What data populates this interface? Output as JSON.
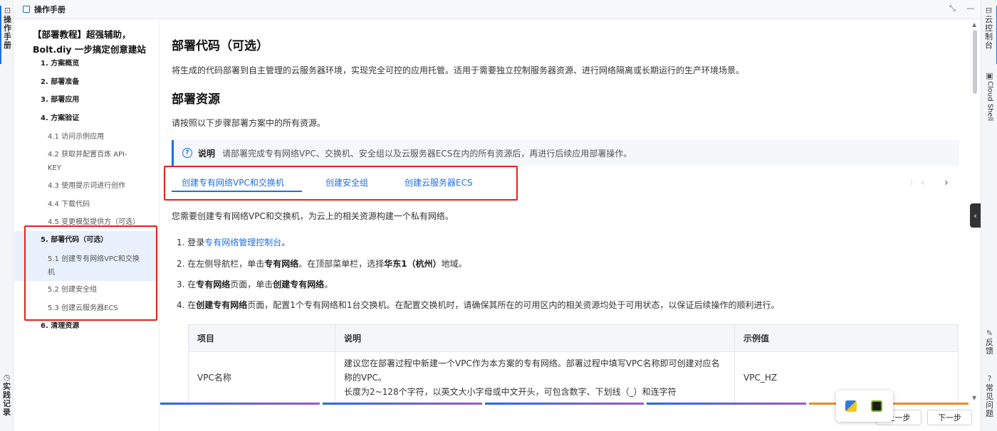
{
  "header": {
    "title": "操作手册"
  },
  "left_rail": {
    "manual_label": "操作手册",
    "practice_label": "实践记录"
  },
  "right_rail": {
    "console_label": "云控制台",
    "cloudshell_label": "Cloud Shell",
    "feedback_label": "反馈",
    "faq_label": "常见问题"
  },
  "toc": {
    "title": "【部署教程】超强辅助，Bolt.diy 一步搞定创意建站",
    "items": [
      {
        "label": "1. 方案概览"
      },
      {
        "label": "2. 部署准备"
      },
      {
        "label": "3. 部署应用"
      },
      {
        "label": "4. 方案验证"
      }
    ],
    "sub4": [
      {
        "label": "4.1 访问示例应用"
      },
      {
        "label": "4.2 获取并配置百炼 API-KEY"
      },
      {
        "label": "4.3 使用提示词进行创作"
      },
      {
        "label": "4.4 下载代码"
      },
      {
        "label": "4.5 变更模型提供方（可选）"
      }
    ],
    "item5": "5. 部署代码（可选）",
    "sub5": [
      {
        "label": "5.1 创建专有网络VPC和交换机"
      },
      {
        "label": "5.2 创建安全组"
      },
      {
        "label": "5.3 创建云服务器ECS"
      }
    ],
    "item6": "6. 清理资源"
  },
  "content": {
    "h1": "部署代码（可选）",
    "intro": "将生成的代码部署到自主管理的云服务器环境，实现完全可控的应用托管。适用于需要独立控制服务器资源、进行网络隔离或长期运行的生产环境场景。",
    "h2": "部署资源",
    "h2_text": "请按照以下步骤部署方案中的所有资源。",
    "note_label": "说明",
    "note_text": "请部署完成专有网络VPC、交换机、安全组以及云服务器ECS在内的所有资源后，再进行后续应用部署操作。",
    "tabs": [
      "创建专有网络VPC和交换机",
      "创建安全组",
      "创建云服务器ECS"
    ],
    "tab_desc": "您需要创建专有网络VPC和交换机，为云上的相关资源构建一个私有网络。",
    "steps": {
      "s1_pre": "1. 登录",
      "s1_link": "专有网络管理控制台",
      "s1_post": "。",
      "s2_a": "2. 在左侧导航栏，单击",
      "s2_b": "专有网络",
      "s2_c": "。在顶部菜单栏，选择",
      "s2_d": "华东1（杭州）",
      "s2_e": "地域。",
      "s3_a": "3. 在",
      "s3_b": "专有网络",
      "s3_c": "页面，单击",
      "s3_d": "创建专有网络",
      "s3_e": "。",
      "s4_a": "4. 在",
      "s4_b": "创建专有网络",
      "s4_c": "页面，配置1个专有网络和1台交换机。在配置交换机时，请确保其所在的可用区内的相关资源均处于可用状态，以保证后续操作的顺利进行。"
    },
    "table": {
      "headers": [
        "项目",
        "说明",
        "示例值"
      ],
      "row": {
        "item": "VPC名称",
        "desc1": "建议您在部署过程中新建一个VPC作为本方案的专有网络。部署过程中填写VPC名称即可创建对应名称的VPC。",
        "desc2": "长度为2~128个字符，以英文大小字母或中文开头，可包含数字、下划线（_）和连字符",
        "example": "VPC_HZ"
      }
    }
  },
  "bottom": {
    "prev_label": "上一步",
    "next_label": "下一步"
  },
  "colors": {
    "accent": "#1f6fde",
    "highlight_red": "#e3221c",
    "active_bg": "#e8f0fc"
  }
}
